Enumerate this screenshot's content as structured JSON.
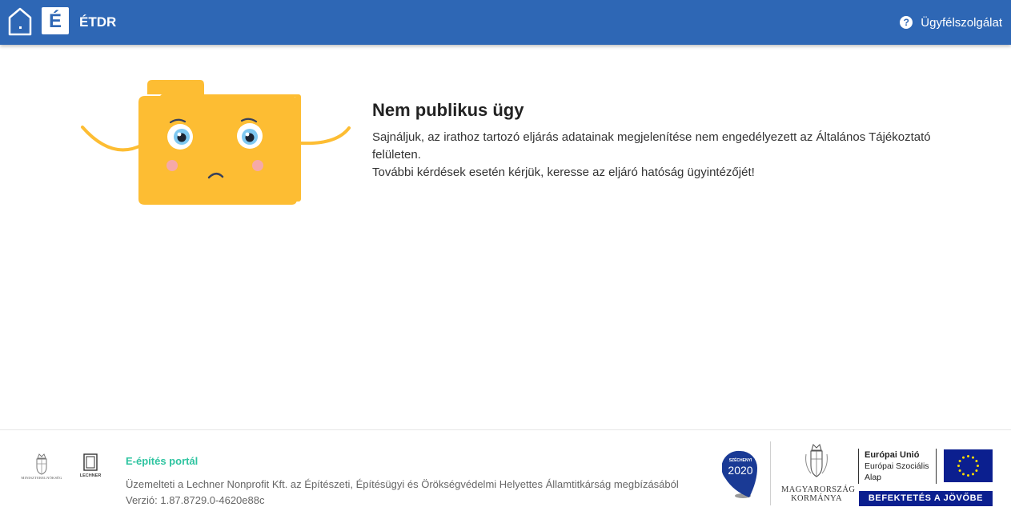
{
  "header": {
    "logo_letter": "É",
    "app_title": "ÉTDR",
    "help_label": "Ügyfélszolgálat",
    "help_icon_glyph": "?",
    "background_color": "#2e67b5"
  },
  "main": {
    "title": "Nem publikus ügy",
    "message_line1": "Sajnáljuk, az irathoz tartozó eljárás adatainak megjelenítése nem engedélyezett az Általános Tájékoztató felületen.",
    "message_line2": "További kérdések esetén kérjük, keresse az eljáró hatóság ügyintézőjét!",
    "illustration": "sad-folder-icon",
    "illustration_color": "#fdbd33"
  },
  "footer": {
    "ministry_label": "MINISZTERELNÖKSÉG",
    "lechner_label": "LECHNER",
    "portal_name": "E-építés portál",
    "operator_text": "Üzemelteti a Lechner Nonprofit Kft. az Építészeti, Építésügyi és Örökségvédelmi Helyettes Államtitkárság megbízásából",
    "version_text": "Verzió: 1.87.8729.0-4620e88c",
    "szechenyi_label": "SZÉCHENYI",
    "szechenyi_year": "2020",
    "government_line1": "MAGYARORSZÁG",
    "government_line2": "KORMÁNYA",
    "eu_title": "Európai Unió",
    "eu_fund_line1": "Európai Szociális",
    "eu_fund_line2": "Alap",
    "invest_banner": "BEFEKTETÉS A JÖVŐBE",
    "portal_name_color": "#2ec4a0",
    "eu_blue": "#0b1f8f"
  }
}
